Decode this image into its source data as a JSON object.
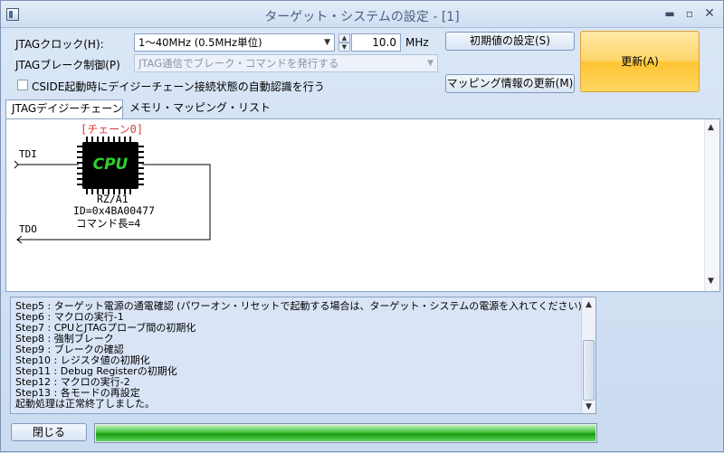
{
  "window": {
    "title": "ターゲット・システムの設定 - [1]",
    "min_glyph": "▬",
    "max_glyph": "▫",
    "close_glyph": "✕"
  },
  "settings": {
    "jtag_clock_label": "JTAGクロック(H):",
    "jtag_clock_value": "1～40MHz (0.5MHz単位)",
    "clock_number": "10.0",
    "clock_unit": "MHz",
    "jtag_break_label": "JTAGブレーク制御(P)",
    "jtag_break_value": "JTAG通信でブレーク・コマンドを発行する",
    "auto_detect_label": "CSIDE起動時にデイジーチェーン接続状態の自動認識を行う",
    "auto_detect_checked": false
  },
  "buttons": {
    "init_label": "初期値の設定(S)",
    "mapping_label": "マッピング情報の更新(M)",
    "update_label": "更新(A)",
    "close_label": "閉じる"
  },
  "tabs": [
    {
      "label": "JTAGデイジーチェーン",
      "active": true
    },
    {
      "label": "メモリ・マッピング・リスト",
      "active": false
    }
  ],
  "chain": {
    "chain_label": "[チェーン0]",
    "tdi": "TDI",
    "tdo": "TDO",
    "chip_text": "CPU",
    "device_name": "RZ/A1",
    "device_id": "ID=0x4BA00477",
    "command_length": "コマンド長=4"
  },
  "log": [
    "Step5 : ターゲット電源の通電確認 (パワーオン・リセットで起動する場合は、ターゲット・システムの電源を入れてください)",
    "Step6 : マクロの実行-1",
    "Step7 : CPUとJTAGプローブ間の初期化",
    "Step8 : 強制ブレーク",
    "Step9 : ブレークの確認",
    "Step10 : レジスタ値の初期化",
    "Step11 : Debug Registerの初期化",
    "Step12 : マクロの実行-2",
    "Step13 : 各モードの再設定",
    "起動処理は正常終了しました。"
  ],
  "progress": {
    "value": 1.0
  },
  "colors": {
    "accent_update": "#ffc533",
    "progress_green": "#1a9b14",
    "chip_text": "#2fd12f",
    "chain_label": "#d83a3a"
  },
  "icons": {
    "dropdown": "▼",
    "spin_up": "▲",
    "spin_down": "▼",
    "scroll_up": "▲",
    "scroll_down": "▼"
  }
}
